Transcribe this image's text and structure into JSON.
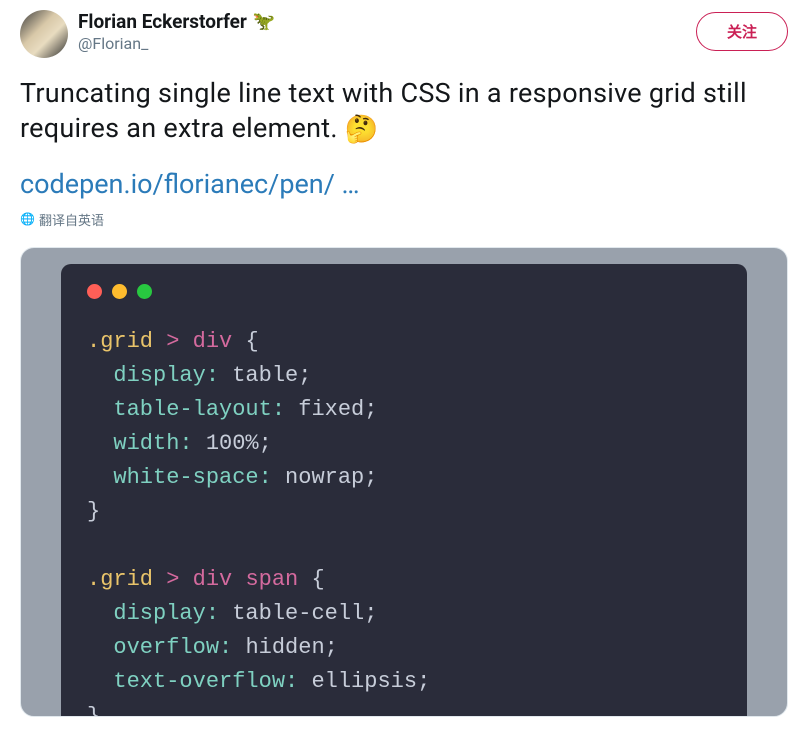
{
  "author": {
    "display_name": "Florian Eckerstorfer",
    "emoji": "🦖",
    "handle": "@Florian_"
  },
  "actions": {
    "follow_label": "关注"
  },
  "tweet": {
    "text": "Truncating single line text with CSS in a responsive grid still requires an extra element. ",
    "emoji": "🤔",
    "link_text": "codepen.io/florianec/pen/ …"
  },
  "translate": {
    "label": "翻译自英语"
  },
  "code": {
    "block1": {
      "selector_class": ".grid",
      "selector_op": ">",
      "selector_tag": "div",
      "lines": [
        {
          "prop": "display",
          "val": "table"
        },
        {
          "prop": "table-layout",
          "val": "fixed"
        },
        {
          "prop": "width",
          "val": "100%"
        },
        {
          "prop": "white-space",
          "val": "nowrap"
        }
      ]
    },
    "block2": {
      "selector_class": ".grid",
      "selector_op": ">",
      "selector_tag": "div",
      "selector_tag2": "span",
      "lines": [
        {
          "prop": "display",
          "val": "table-cell"
        },
        {
          "prop": "overflow",
          "val": "hidden"
        },
        {
          "prop": "text-overflow",
          "val": "ellipsis"
        }
      ]
    }
  }
}
